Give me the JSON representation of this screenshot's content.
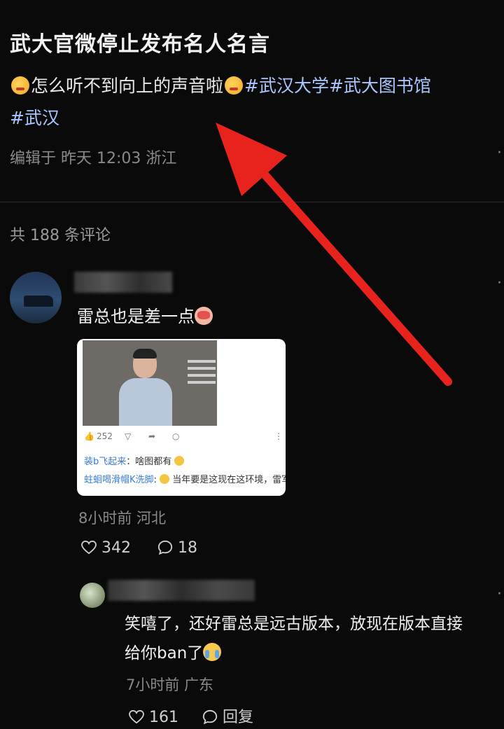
{
  "post": {
    "title": "武大官微停止发布名人名言",
    "text": "怎么听不到向上的声音啦",
    "tags": [
      "#武汉大学",
      "#武大图书馆",
      "#武汉"
    ],
    "meta": "编辑于 昨天 12:03 浙江"
  },
  "comments_count": "共 188 条评论",
  "comment1": {
    "text": "雷总也是差一点",
    "image": {
      "likes": "252",
      "line1_user": "装b飞起来",
      "line1_text": "：啥图都有",
      "line2_user": "蛀蛔喝滑帽K洗脚",
      "line2_text": "当年要是这现在这环境，雷军在图书馆直接折刻了"
    },
    "meta": "8小时前 河北",
    "likes": "342",
    "replies": "18"
  },
  "comment2": {
    "text_line1": "笑嘻了，还好雷总是远古版本，放现在版本直接",
    "text_line2": "给你ban了",
    "meta": "7小时前 广东",
    "likes": "161",
    "reply_label": "回复"
  },
  "colors": {
    "background": "#0a0a0a",
    "tag": "#a9c6ff",
    "arrow": "#e8231d"
  }
}
